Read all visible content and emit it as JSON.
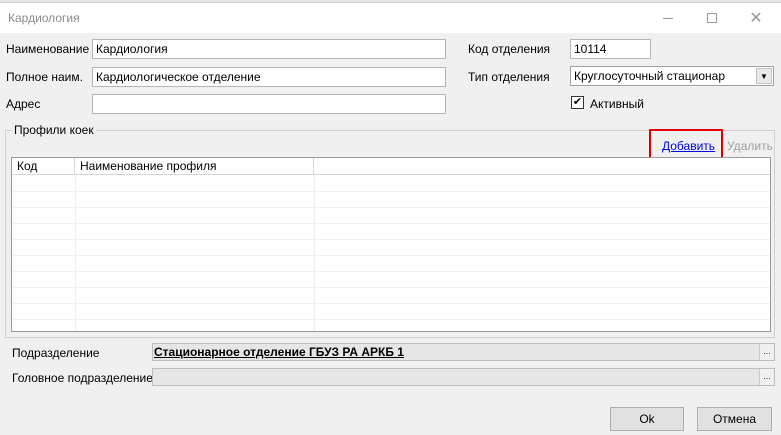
{
  "window": {
    "title": "Кардиология",
    "controls": {
      "minimize_icon": "minimize-icon",
      "maximize_icon": "maximize-icon",
      "close_icon": "close-icon",
      "close_glyph": "✕"
    }
  },
  "form": {
    "name_label": "Наименование",
    "name_value": "Кардиология",
    "full_name_label": "Полное наим.",
    "full_name_value": "Кардиологическое отделение",
    "address_label": "Адрес",
    "address_value": "",
    "dept_code_label": "Код отделения",
    "dept_code_value": "10114",
    "dept_type_label": "Тип отделения",
    "dept_type_value": "Круглосуточный стационар",
    "dropdown_arrow": "▼",
    "active_label": "Активный",
    "active_checked": true,
    "check_glyph": "✔"
  },
  "profiles": {
    "group_title": "Профили коек",
    "add_link": "Добавить",
    "delete_link": "Удалить",
    "columns": [
      "Код",
      "Наименование профиля"
    ],
    "rows": []
  },
  "bottom": {
    "subdivision_label": "Подразделение",
    "subdivision_value": "Стационарное отделение ГБУЗ РА АРКБ 1",
    "parent_label": "Головное подразделение",
    "parent_value": "",
    "ellipsis": "..."
  },
  "buttons": {
    "ok": "Ok",
    "cancel": "Отмена"
  },
  "colors": {
    "highlight": "#e00000",
    "link": "#0000ee"
  }
}
